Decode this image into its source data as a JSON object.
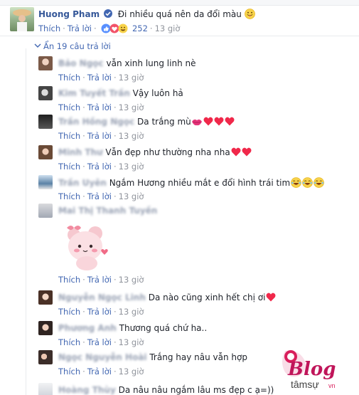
{
  "main_comment": {
    "name": "Huong Pham",
    "text": "Đi nhiều quá nên da đổi màu",
    "like": "Thích",
    "reply": "Trả lời",
    "reaction_count": "252",
    "time": "13 giờ"
  },
  "replies_toggle": "Ẩn 19 câu trả lời",
  "replies": [
    {
      "name": "Bảo Ngọc",
      "text": "vẫn xinh lung linh nè",
      "like": "Thích",
      "reply": "Trả lời",
      "time": "13 giờ"
    },
    {
      "name": "Kim Tuyết Trần",
      "text": "Vậy luôn hả",
      "like": "Thích",
      "reply": "Trả lời",
      "time": "13 giờ"
    },
    {
      "name": "Trần Hồng Ngọc",
      "text": "Da trắng mù",
      "like": "Thích",
      "reply": "Trả lời",
      "time": "13 giờ"
    },
    {
      "name": "Minh Thư",
      "text": "Vẫn đẹp như thường nha nha",
      "like": "Thích",
      "reply": "Trả lời",
      "time": "13 giờ"
    },
    {
      "name": "Trần Uyên",
      "text": "Ngắm Hương nhiều mắt e đổi hình trái tim",
      "like": "Thích",
      "reply": "Trả lời",
      "time": "13 giờ"
    },
    {
      "name": "Mai Thị Thanh Tuyền",
      "text": "",
      "like": "Thích",
      "reply": "Trả lời",
      "time": "13 giờ"
    },
    {
      "name": "Nguyễn Ngọc Linh",
      "text": "Da nào cũng xinh hết chị ơi",
      "like": "Thích",
      "reply": "Trả lời",
      "time": "13 giờ"
    },
    {
      "name": "Phương Anh",
      "text": "Thương quá chứ ha..",
      "like": "Thích",
      "reply": "Trả lời",
      "time": "13 giờ"
    },
    {
      "name": "Ngọc Nguyễn Hoài",
      "text": "Trắng hay nâu vẫn hợp",
      "like": "Thích",
      "reply": "Trả lời",
      "time": "13 giờ"
    },
    {
      "name": "Hoàng Thùy",
      "text": "Da nâu nâu ngắm lâu ms đẹp c ạ=))",
      "like": "",
      "reply": "",
      "time": ""
    }
  ],
  "watermark": {
    "word": "Blog",
    "sub": "tâmsự",
    "suffix": "vn"
  },
  "colors": {
    "link": "#4267b2",
    "name": "#365899",
    "meta": "#90949c",
    "heart": "#f0284a"
  }
}
